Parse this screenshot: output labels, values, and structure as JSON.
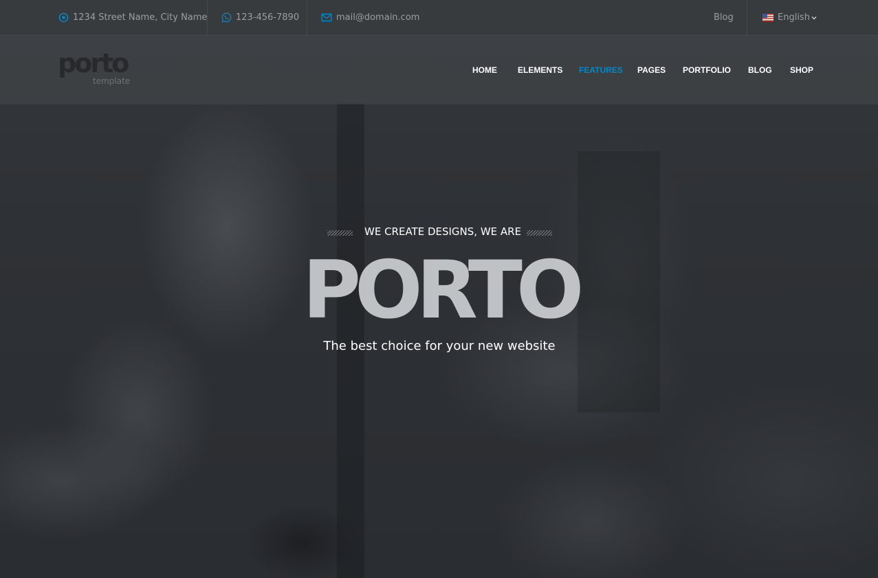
{
  "topbar": {
    "address": "1234 Street Name, City Name",
    "phone": "123-456-7890",
    "email": "mail@domain.com",
    "blog_link": "Blog",
    "language": "English",
    "icons": {
      "address": "location-icon",
      "phone": "whatsapp-icon",
      "email": "envelope-icon",
      "language": "us-flag-icon",
      "language_caret": "chevron-down-icon"
    }
  },
  "header": {
    "logo_word": "porto",
    "logo_sub": "template",
    "nav": [
      {
        "label": "HOME",
        "active": false
      },
      {
        "label": "ELEMENTS",
        "active": false
      },
      {
        "label": "FEATURES",
        "active": true
      },
      {
        "label": "PAGES",
        "active": false
      },
      {
        "label": "PORTFOLIO",
        "active": false
      },
      {
        "label": "BLOG",
        "active": false
      },
      {
        "label": "SHOP",
        "active": false
      }
    ]
  },
  "hero": {
    "tagline": "WE CREATE DESIGNS, WE ARE",
    "title": "PORTO",
    "subtitle": "The best choice for your new website"
  },
  "colors": {
    "accent": "#0088cc",
    "nav_text": "#ffffff",
    "topbar_text": "#9a9ea3"
  }
}
